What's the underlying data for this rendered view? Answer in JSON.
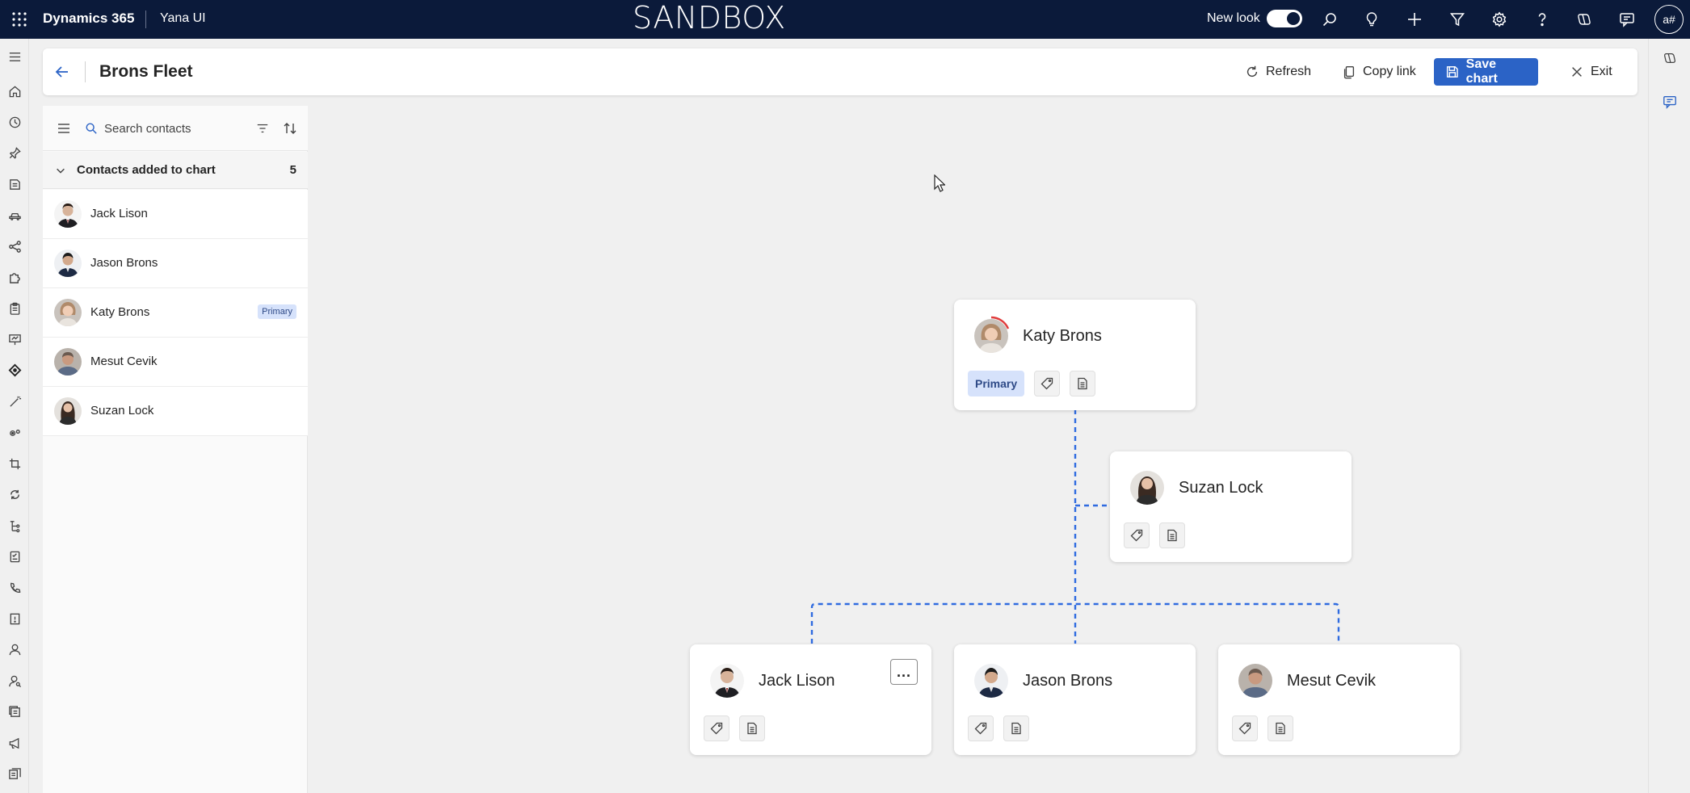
{
  "topbar": {
    "brand": "Dynamics 365",
    "app_name": "Yana UI",
    "environment_label": "SANDBOX",
    "new_look_label": "New look",
    "new_look_on": true,
    "avatar_initials": "a#",
    "icons": [
      "search-icon",
      "lightbulb-icon",
      "plus-icon",
      "filter-icon",
      "gear-icon",
      "help-icon",
      "copilot-icon",
      "chat-icon"
    ]
  },
  "left_rail_icons": [
    "hamburger-icon",
    "home-icon",
    "recent-icon",
    "pin-icon",
    "book-icon",
    "car-icon",
    "network-icon",
    "puzzle-icon",
    "clipboard-icon",
    "presentation-icon",
    "diamond-icon",
    "wand-icon",
    "gears-icon",
    "crop-icon",
    "sync-icon",
    "tree-icon",
    "checklist-icon",
    "phone-icon",
    "report-icon",
    "person-icon",
    "person-search-icon",
    "document-stack-icon",
    "megaphone-icon",
    "document-icon"
  ],
  "header": {
    "title": "Brons Fleet",
    "refresh_label": "Refresh",
    "copy_link_label": "Copy link",
    "save_chart_label": "Save chart",
    "exit_label": "Exit"
  },
  "panel": {
    "search_placeholder": "Search contacts",
    "group_label": "Contacts added to chart",
    "group_count": "5",
    "contacts": [
      {
        "name": "Jack Lison",
        "badge": ""
      },
      {
        "name": "Jason Brons",
        "badge": ""
      },
      {
        "name": "Katy Brons",
        "badge": "Primary"
      },
      {
        "name": "Mesut Cevik",
        "badge": ""
      },
      {
        "name": "Suzan Lock",
        "badge": ""
      }
    ]
  },
  "chart": {
    "nodes": [
      {
        "name": "Katy Brons",
        "badge": "Primary"
      },
      {
        "name": "Suzan Lock"
      },
      {
        "name": "Jack Lison"
      },
      {
        "name": "Jason Brons"
      },
      {
        "name": "Mesut Cevik"
      }
    ],
    "more_label": "..."
  },
  "colors": {
    "topbar_bg": "#0b1a3a",
    "accent": "#2b63c6",
    "connector": "#2f6be0",
    "primary_badge_bg": "#d6e2fb"
  }
}
